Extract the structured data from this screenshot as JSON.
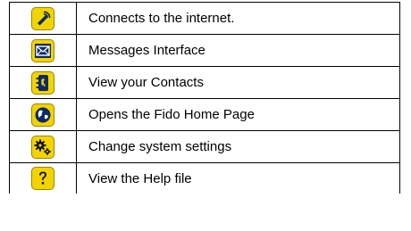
{
  "legend": {
    "rows": [
      {
        "icon": "internet-connect-icon",
        "label": "Connects to the internet."
      },
      {
        "icon": "envelope-icon",
        "label": "Messages Interface"
      },
      {
        "icon": "contacts-phone-icon",
        "label": "View your Contacts"
      },
      {
        "icon": "globe-icon",
        "label": "Opens the Fido Home Page"
      },
      {
        "icon": "gears-icon",
        "label": "Change system settings"
      },
      {
        "icon": "question-mark-icon",
        "label": "View the Help file"
      }
    ]
  },
  "colors": {
    "icon_background": "#f3d400",
    "icon_glyph": "#0b2a6b",
    "border": "#000000"
  }
}
